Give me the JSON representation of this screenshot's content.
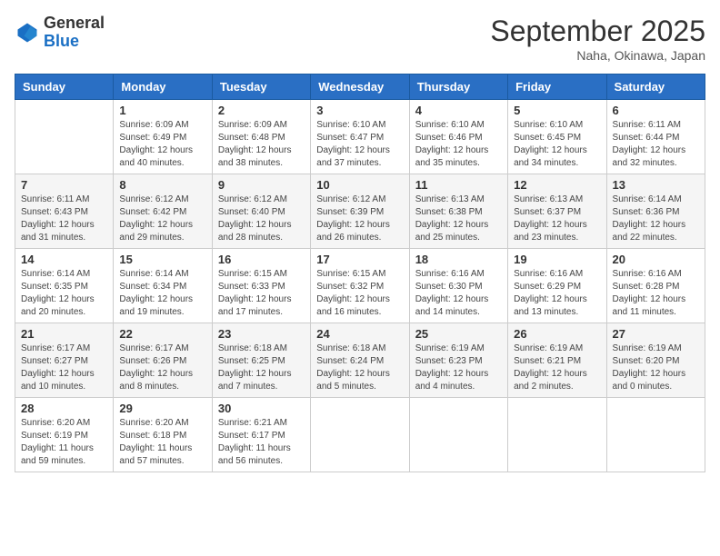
{
  "header": {
    "logo_general": "General",
    "logo_blue": "Blue",
    "month_title": "September 2025",
    "location": "Naha, Okinawa, Japan"
  },
  "weekdays": [
    "Sunday",
    "Monday",
    "Tuesday",
    "Wednesday",
    "Thursday",
    "Friday",
    "Saturday"
  ],
  "weeks": [
    [
      {
        "day": "",
        "sunrise": "",
        "sunset": "",
        "daylight": ""
      },
      {
        "day": "1",
        "sunrise": "Sunrise: 6:09 AM",
        "sunset": "Sunset: 6:49 PM",
        "daylight": "Daylight: 12 hours and 40 minutes."
      },
      {
        "day": "2",
        "sunrise": "Sunrise: 6:09 AM",
        "sunset": "Sunset: 6:48 PM",
        "daylight": "Daylight: 12 hours and 38 minutes."
      },
      {
        "day": "3",
        "sunrise": "Sunrise: 6:10 AM",
        "sunset": "Sunset: 6:47 PM",
        "daylight": "Daylight: 12 hours and 37 minutes."
      },
      {
        "day": "4",
        "sunrise": "Sunrise: 6:10 AM",
        "sunset": "Sunset: 6:46 PM",
        "daylight": "Daylight: 12 hours and 35 minutes."
      },
      {
        "day": "5",
        "sunrise": "Sunrise: 6:10 AM",
        "sunset": "Sunset: 6:45 PM",
        "daylight": "Daylight: 12 hours and 34 minutes."
      },
      {
        "day": "6",
        "sunrise": "Sunrise: 6:11 AM",
        "sunset": "Sunset: 6:44 PM",
        "daylight": "Daylight: 12 hours and 32 minutes."
      }
    ],
    [
      {
        "day": "7",
        "sunrise": "Sunrise: 6:11 AM",
        "sunset": "Sunset: 6:43 PM",
        "daylight": "Daylight: 12 hours and 31 minutes."
      },
      {
        "day": "8",
        "sunrise": "Sunrise: 6:12 AM",
        "sunset": "Sunset: 6:42 PM",
        "daylight": "Daylight: 12 hours and 29 minutes."
      },
      {
        "day": "9",
        "sunrise": "Sunrise: 6:12 AM",
        "sunset": "Sunset: 6:40 PM",
        "daylight": "Daylight: 12 hours and 28 minutes."
      },
      {
        "day": "10",
        "sunrise": "Sunrise: 6:12 AM",
        "sunset": "Sunset: 6:39 PM",
        "daylight": "Daylight: 12 hours and 26 minutes."
      },
      {
        "day": "11",
        "sunrise": "Sunrise: 6:13 AM",
        "sunset": "Sunset: 6:38 PM",
        "daylight": "Daylight: 12 hours and 25 minutes."
      },
      {
        "day": "12",
        "sunrise": "Sunrise: 6:13 AM",
        "sunset": "Sunset: 6:37 PM",
        "daylight": "Daylight: 12 hours and 23 minutes."
      },
      {
        "day": "13",
        "sunrise": "Sunrise: 6:14 AM",
        "sunset": "Sunset: 6:36 PM",
        "daylight": "Daylight: 12 hours and 22 minutes."
      }
    ],
    [
      {
        "day": "14",
        "sunrise": "Sunrise: 6:14 AM",
        "sunset": "Sunset: 6:35 PM",
        "daylight": "Daylight: 12 hours and 20 minutes."
      },
      {
        "day": "15",
        "sunrise": "Sunrise: 6:14 AM",
        "sunset": "Sunset: 6:34 PM",
        "daylight": "Daylight: 12 hours and 19 minutes."
      },
      {
        "day": "16",
        "sunrise": "Sunrise: 6:15 AM",
        "sunset": "Sunset: 6:33 PM",
        "daylight": "Daylight: 12 hours and 17 minutes."
      },
      {
        "day": "17",
        "sunrise": "Sunrise: 6:15 AM",
        "sunset": "Sunset: 6:32 PM",
        "daylight": "Daylight: 12 hours and 16 minutes."
      },
      {
        "day": "18",
        "sunrise": "Sunrise: 6:16 AM",
        "sunset": "Sunset: 6:30 PM",
        "daylight": "Daylight: 12 hours and 14 minutes."
      },
      {
        "day": "19",
        "sunrise": "Sunrise: 6:16 AM",
        "sunset": "Sunset: 6:29 PM",
        "daylight": "Daylight: 12 hours and 13 minutes."
      },
      {
        "day": "20",
        "sunrise": "Sunrise: 6:16 AM",
        "sunset": "Sunset: 6:28 PM",
        "daylight": "Daylight: 12 hours and 11 minutes."
      }
    ],
    [
      {
        "day": "21",
        "sunrise": "Sunrise: 6:17 AM",
        "sunset": "Sunset: 6:27 PM",
        "daylight": "Daylight: 12 hours and 10 minutes."
      },
      {
        "day": "22",
        "sunrise": "Sunrise: 6:17 AM",
        "sunset": "Sunset: 6:26 PM",
        "daylight": "Daylight: 12 hours and 8 minutes."
      },
      {
        "day": "23",
        "sunrise": "Sunrise: 6:18 AM",
        "sunset": "Sunset: 6:25 PM",
        "daylight": "Daylight: 12 hours and 7 minutes."
      },
      {
        "day": "24",
        "sunrise": "Sunrise: 6:18 AM",
        "sunset": "Sunset: 6:24 PM",
        "daylight": "Daylight: 12 hours and 5 minutes."
      },
      {
        "day": "25",
        "sunrise": "Sunrise: 6:19 AM",
        "sunset": "Sunset: 6:23 PM",
        "daylight": "Daylight: 12 hours and 4 minutes."
      },
      {
        "day": "26",
        "sunrise": "Sunrise: 6:19 AM",
        "sunset": "Sunset: 6:21 PM",
        "daylight": "Daylight: 12 hours and 2 minutes."
      },
      {
        "day": "27",
        "sunrise": "Sunrise: 6:19 AM",
        "sunset": "Sunset: 6:20 PM",
        "daylight": "Daylight: 12 hours and 0 minutes."
      }
    ],
    [
      {
        "day": "28",
        "sunrise": "Sunrise: 6:20 AM",
        "sunset": "Sunset: 6:19 PM",
        "daylight": "Daylight: 11 hours and 59 minutes."
      },
      {
        "day": "29",
        "sunrise": "Sunrise: 6:20 AM",
        "sunset": "Sunset: 6:18 PM",
        "daylight": "Daylight: 11 hours and 57 minutes."
      },
      {
        "day": "30",
        "sunrise": "Sunrise: 6:21 AM",
        "sunset": "Sunset: 6:17 PM",
        "daylight": "Daylight: 11 hours and 56 minutes."
      },
      {
        "day": "",
        "sunrise": "",
        "sunset": "",
        "daylight": ""
      },
      {
        "day": "",
        "sunrise": "",
        "sunset": "",
        "daylight": ""
      },
      {
        "day": "",
        "sunrise": "",
        "sunset": "",
        "daylight": ""
      },
      {
        "day": "",
        "sunrise": "",
        "sunset": "",
        "daylight": ""
      }
    ]
  ]
}
